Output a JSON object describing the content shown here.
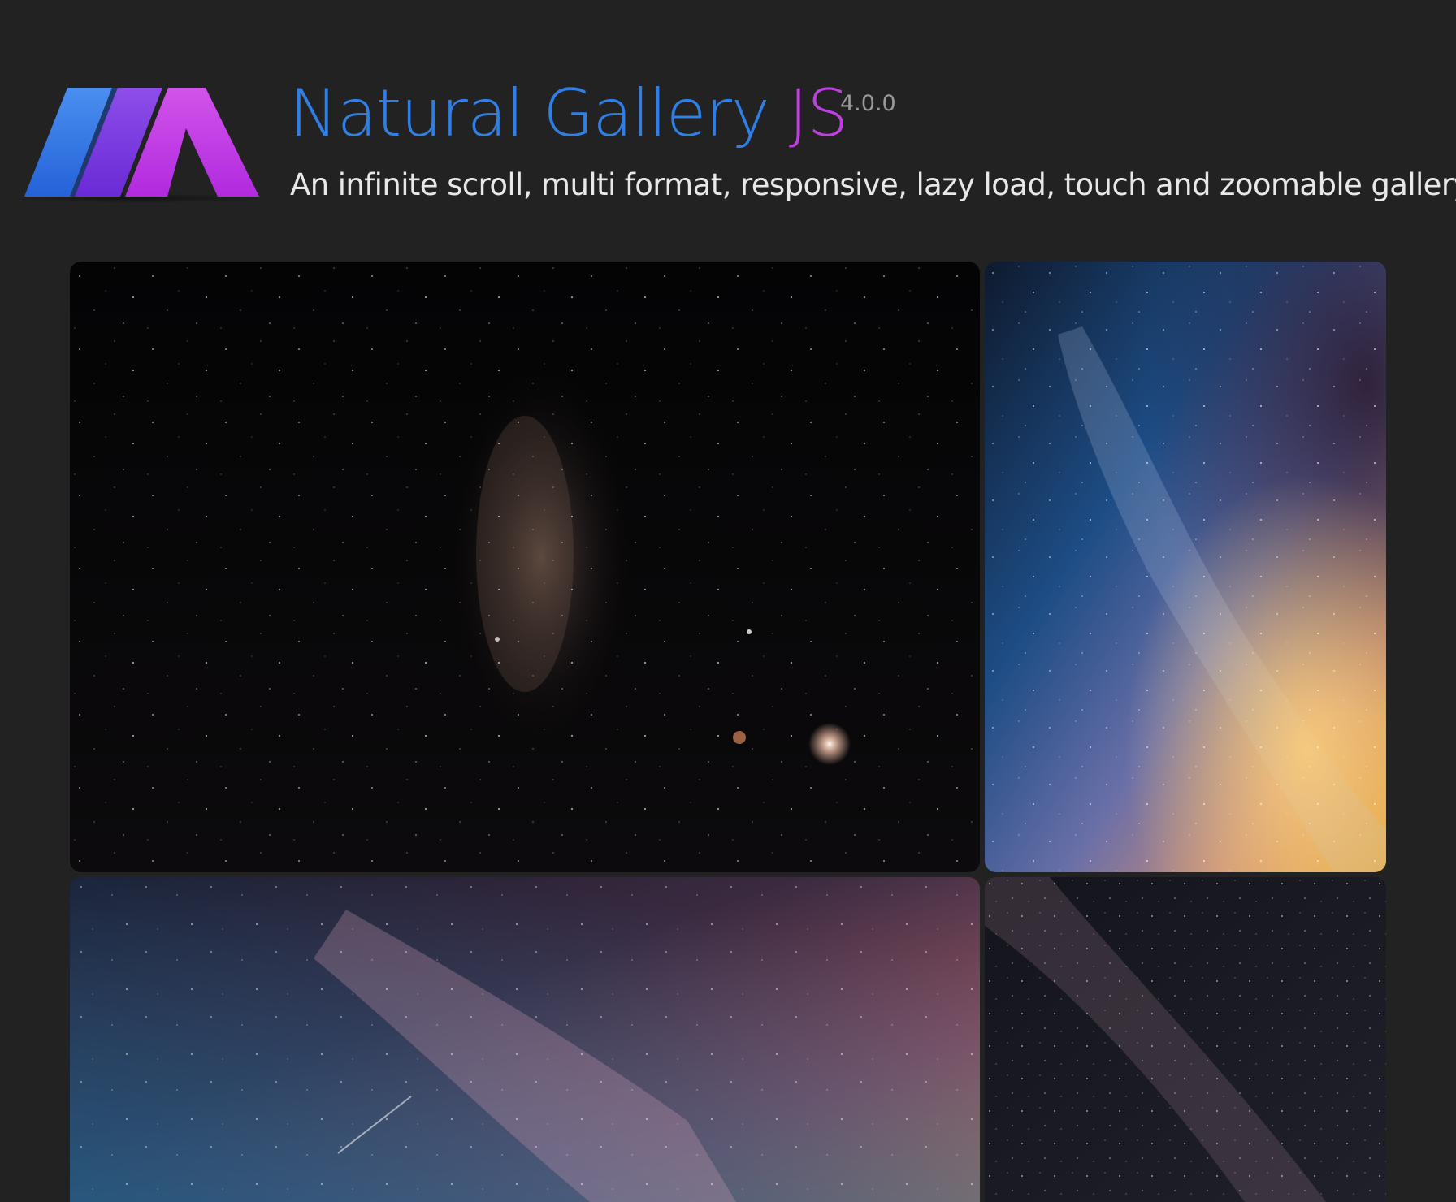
{
  "header": {
    "title_part1": "Natural Gallery",
    "title_part2": "JS",
    "version": "4.0.0",
    "tagline": "An infinite scroll, multi format, responsive, lazy load, touch and zoomable gallery"
  },
  "colors": {
    "background": "#222222",
    "title_blue": "#2f7fe6",
    "title_purple": "#c13ee2",
    "version_gray": "#9a9a9a",
    "tagline": "#e8e8e8"
  },
  "icons": {
    "logo": "natural-gallery-logo-icon"
  },
  "gallery": {
    "items": [
      {
        "subject": "dark-milky-way-night-sky"
      },
      {
        "subject": "colorful-milky-way-galaxy"
      },
      {
        "subject": "pink-sunset-milky-way"
      },
      {
        "subject": "starry-milky-way-band"
      }
    ]
  }
}
